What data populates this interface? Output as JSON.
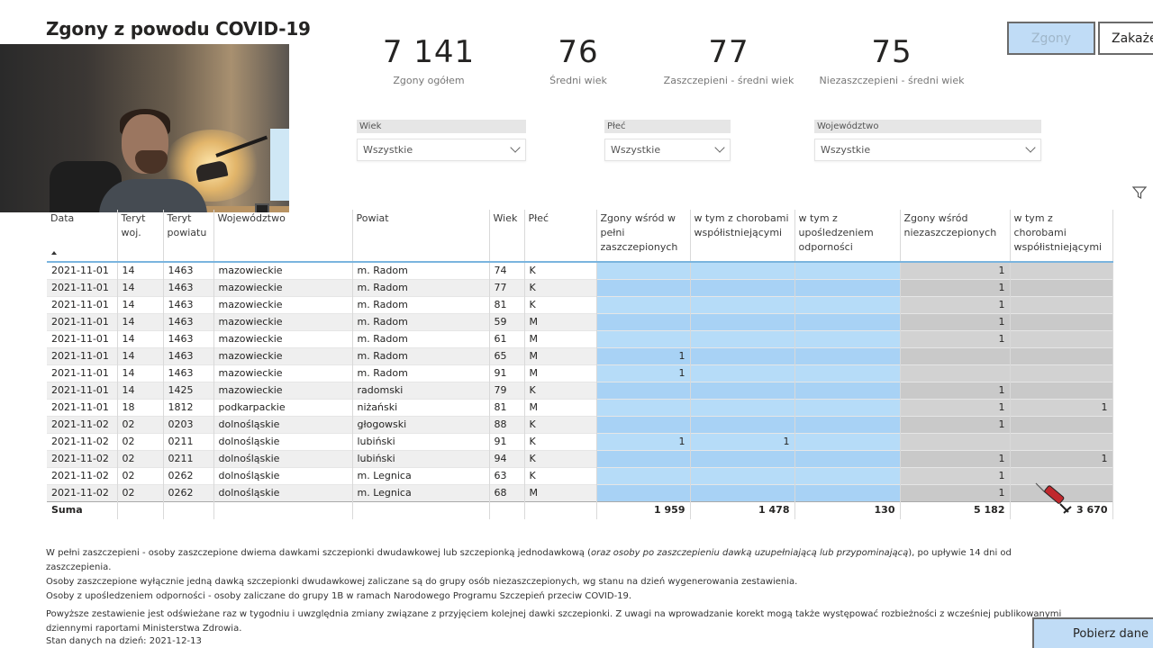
{
  "page": {
    "title": "Zgony z powodu COVID-19"
  },
  "kpis": [
    {
      "value": "7 141",
      "label": "Zgony ogółem"
    },
    {
      "value": "76",
      "label": "Średni wiek"
    },
    {
      "value": "77",
      "label": "Zaszczepieni - średni wiek"
    },
    {
      "value": "75",
      "label": "Niezaszczepieni - średni wiek"
    }
  ],
  "buttons": {
    "deaths": "Zgony",
    "infections": "Zakaże",
    "download": "Pobierz dane"
  },
  "slicers": {
    "age": {
      "label": "Wiek",
      "value": "Wszystkie"
    },
    "sex": {
      "label": "Płeć",
      "value": "Wszystkie"
    },
    "voivodeship": {
      "label": "Województwo",
      "value": "Wszystkie"
    }
  },
  "table": {
    "headers": {
      "date": "Data",
      "teryt_woj": "Teryt woj.",
      "teryt_powiat": "Teryt powiatu",
      "voivodeship": "Województwo",
      "county": "Powiat",
      "age": "Wiek",
      "sex": "Płeć",
      "vacc_deaths": "Zgony wśród w pełni zaszczepionych",
      "vacc_comorb": "w tym z chorobami współistniejącymi",
      "vacc_immuno": "w tym z upośledzeniem odporności",
      "unvacc_deaths": "Zgony wśród niezaszczepionych",
      "unvacc_comorb": "w tym z chorobami współistniejącymi"
    },
    "rows": [
      [
        "2021-11-01",
        "14",
        "1463",
        "mazowieckie",
        "m. Radom",
        "74",
        "K",
        "",
        "",
        "",
        "1",
        ""
      ],
      [
        "2021-11-01",
        "14",
        "1463",
        "mazowieckie",
        "m. Radom",
        "77",
        "K",
        "",
        "",
        "",
        "1",
        ""
      ],
      [
        "2021-11-01",
        "14",
        "1463",
        "mazowieckie",
        "m. Radom",
        "81",
        "K",
        "",
        "",
        "",
        "1",
        ""
      ],
      [
        "2021-11-01",
        "14",
        "1463",
        "mazowieckie",
        "m. Radom",
        "59",
        "M",
        "",
        "",
        "",
        "1",
        ""
      ],
      [
        "2021-11-01",
        "14",
        "1463",
        "mazowieckie",
        "m. Radom",
        "61",
        "M",
        "",
        "",
        "",
        "1",
        ""
      ],
      [
        "2021-11-01",
        "14",
        "1463",
        "mazowieckie",
        "m. Radom",
        "65",
        "M",
        "1",
        "",
        "",
        "",
        ""
      ],
      [
        "2021-11-01",
        "14",
        "1463",
        "mazowieckie",
        "m. Radom",
        "91",
        "M",
        "1",
        "",
        "",
        "",
        ""
      ],
      [
        "2021-11-01",
        "14",
        "1425",
        "mazowieckie",
        "radomski",
        "79",
        "K",
        "",
        "",
        "",
        "1",
        ""
      ],
      [
        "2021-11-01",
        "18",
        "1812",
        "podkarpackie",
        "niżański",
        "81",
        "M",
        "",
        "",
        "",
        "1",
        "1"
      ],
      [
        "2021-11-02",
        "02",
        "0203",
        "dolnośląskie",
        "głogowski",
        "88",
        "K",
        "",
        "",
        "",
        "1",
        ""
      ],
      [
        "2021-11-02",
        "02",
        "0211",
        "dolnośląskie",
        "lubiński",
        "91",
        "K",
        "1",
        "1",
        "",
        "",
        ""
      ],
      [
        "2021-11-02",
        "02",
        "0211",
        "dolnośląskie",
        "lubiński",
        "94",
        "K",
        "",
        "",
        "",
        "1",
        "1"
      ],
      [
        "2021-11-02",
        "02",
        "0262",
        "dolnośląskie",
        "m. Legnica",
        "63",
        "K",
        "",
        "",
        "",
        "1",
        ""
      ],
      [
        "2021-11-02",
        "02",
        "0262",
        "dolnośląskie",
        "m. Legnica",
        "68",
        "M",
        "",
        "",
        "",
        "1",
        ""
      ]
    ],
    "totals": {
      "label": "Suma",
      "vacc_deaths": "1 959",
      "vacc_comorb": "1 478",
      "vacc_immuno": "130",
      "unvacc_deaths": "5 182",
      "unvacc_comorb": "3 670"
    }
  },
  "notes": {
    "line1_pre": "W pełni zaszczepieni - osoby zaszczepione dwiema dawkami szczepionki dwudawkowej lub szczepionką jednodawkową (",
    "line1_em": "oraz osoby po zaszczepieniu dawką uzupełniającą lub przypominającą",
    "line1_post": "), po upływie 14 dni od zaszczepienia.",
    "line2": "Osoby zaszczepione wyłącznie jedną dawką szczepionki dwudawkowej zaliczane są do grupy osób niezaszczepionych, wg stanu na dzień wygenerowania zestawienia.",
    "line3": "Osoby z upośledzeniem odporności - osoby zaliczane do grupy 1B w ramach Narodowego Programu Szczepień przeciw COVID-19.",
    "line4": "Powyższe zestawienie jest odświeżane raz w tygodniu i uwzględnia zmiany związane z przyjęciem kolejnej dawki szczepionki. Z uwagi na wprowadzanie korekt mogą także występować rozbieżności z wcześniej publikowanymi dziennymi raportami Ministerstwa Zdrowia.",
    "status": "Stan danych na dzień: 2021-12-13"
  },
  "colors": {
    "vaccinated": "#b6dcf8",
    "unvaccinated": "#d2d2d2",
    "button": "#c0dcf6"
  },
  "icons": {
    "filter": "filter-icon",
    "cursor": "syringe-cursor-icon"
  }
}
